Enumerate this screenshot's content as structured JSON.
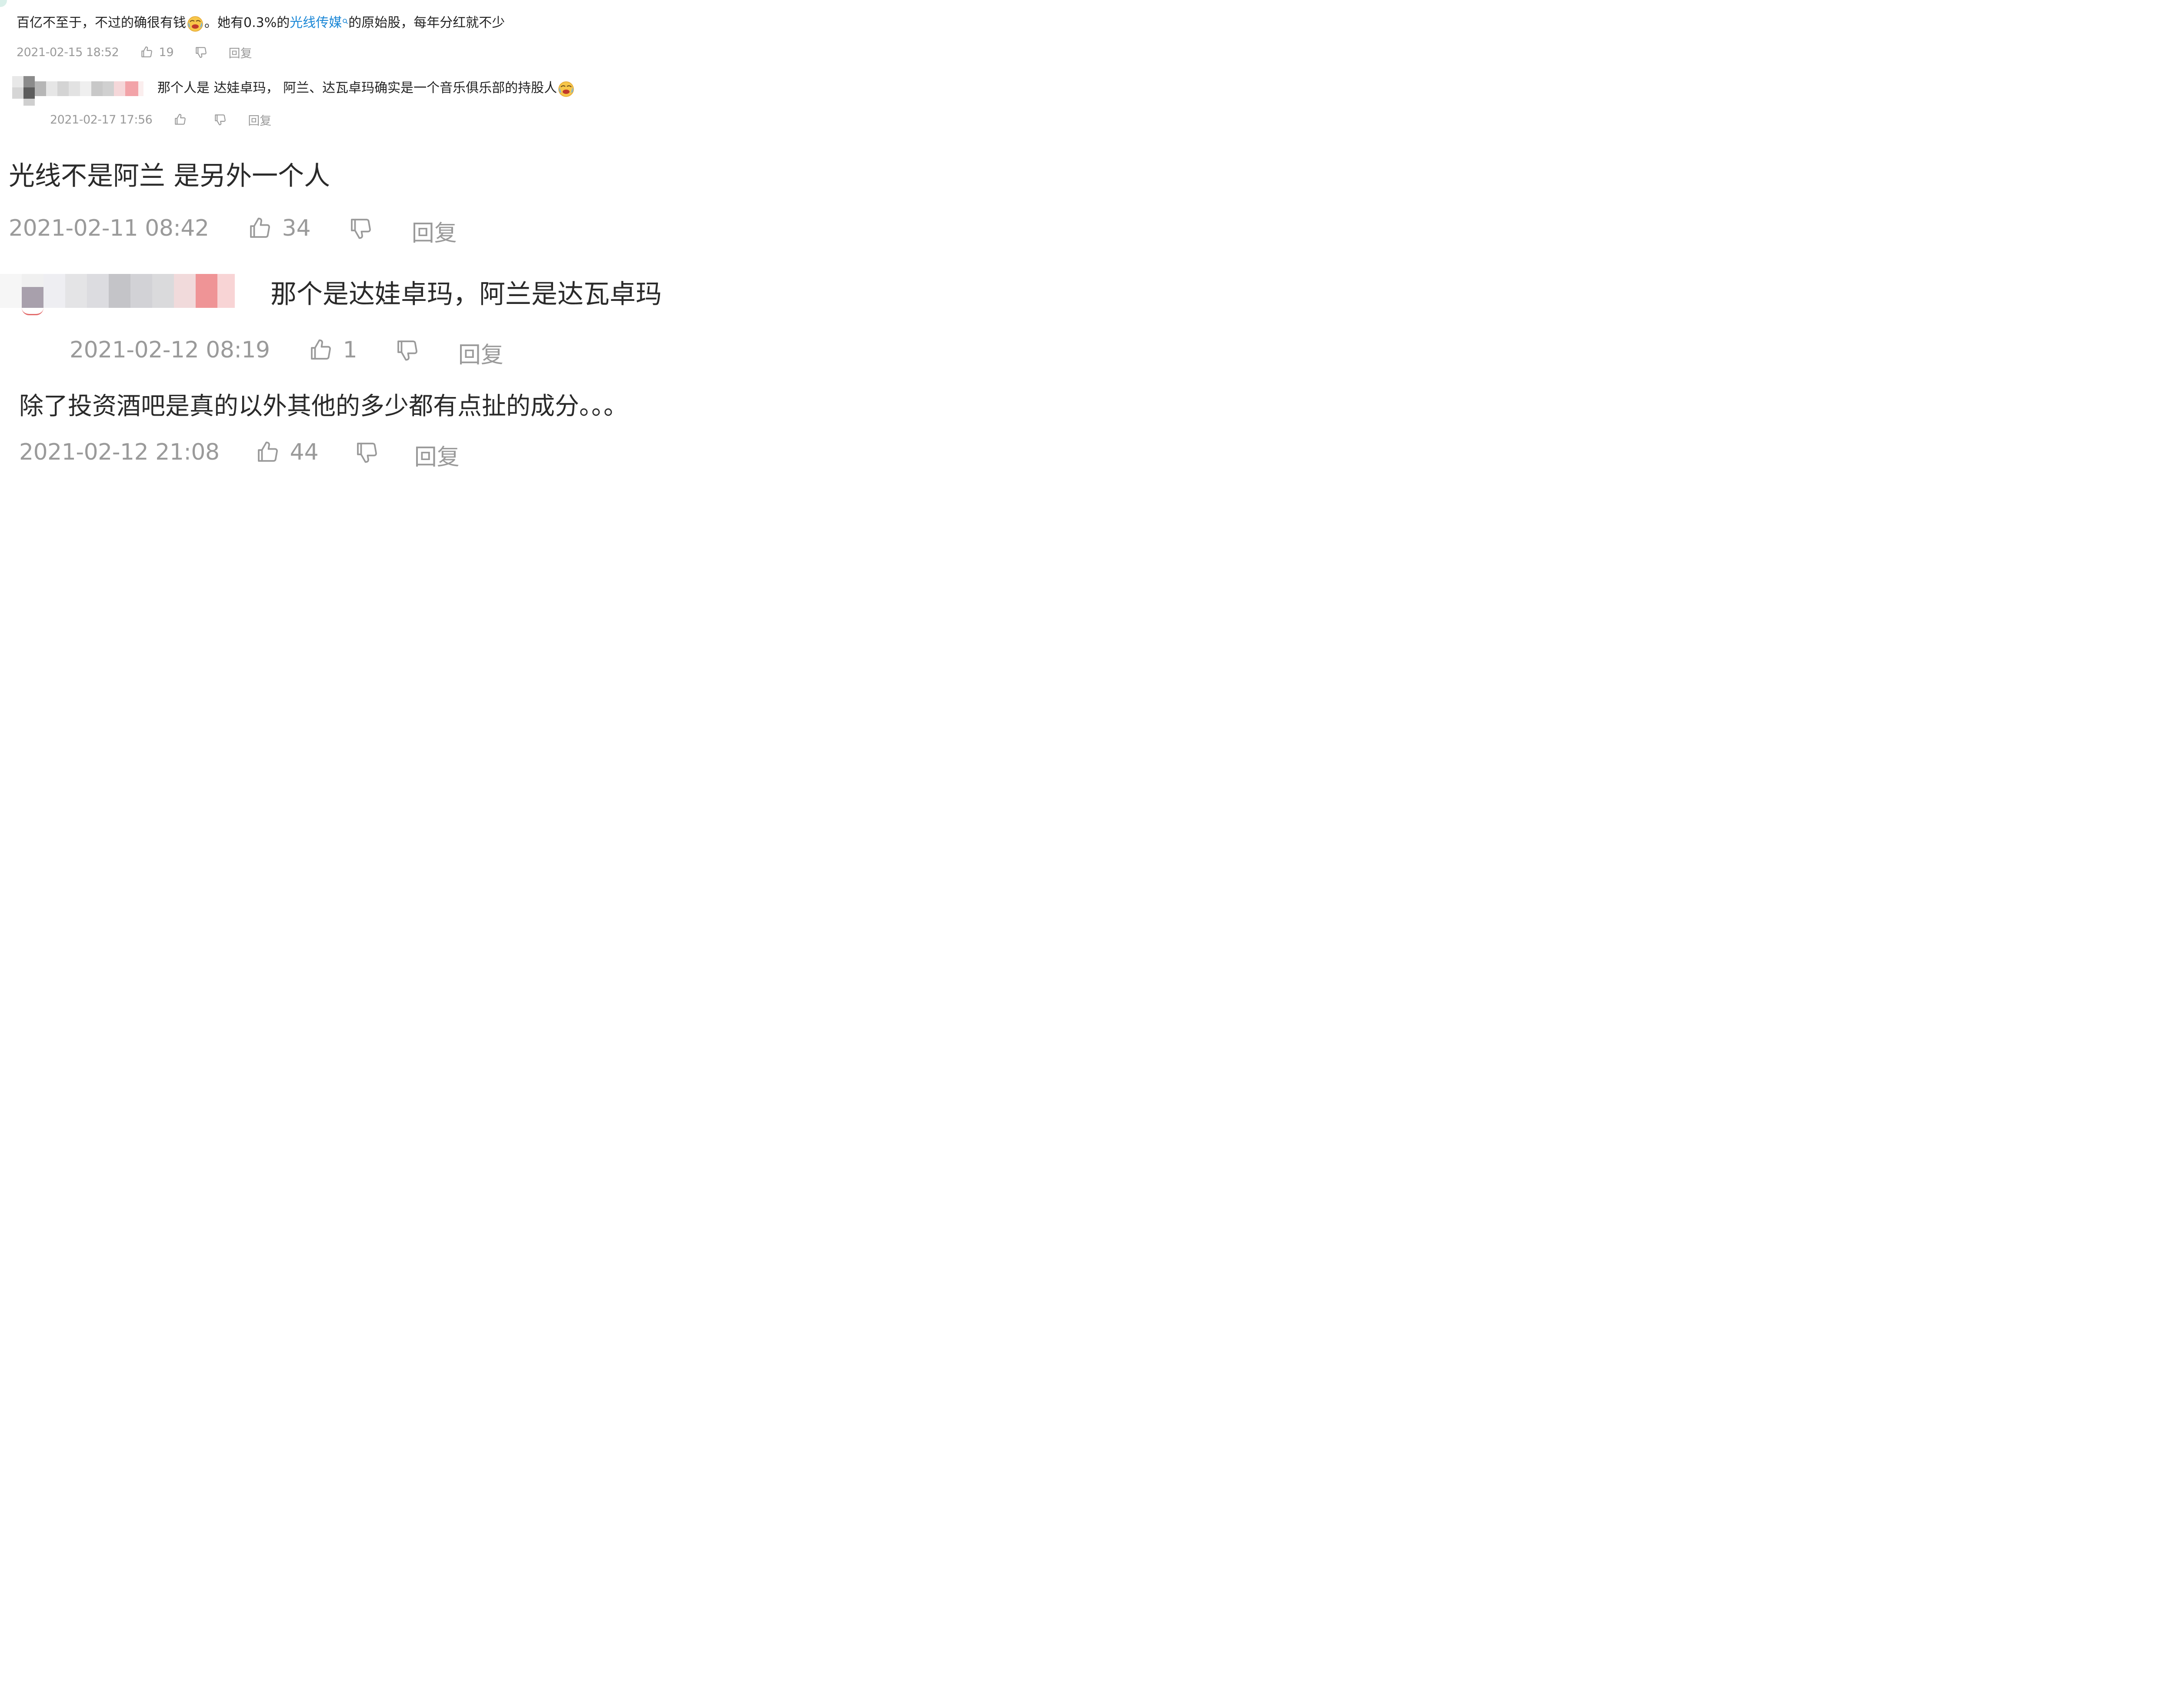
{
  "comments": [
    {
      "id": "c1",
      "text_before": "百亿不至于，不过的确很有钱",
      "text_middle": "。她有0.3%的",
      "link_text": "光线传媒",
      "text_after": "的原始股，每年分红就不少",
      "emoji": "crying-laugh-emoji",
      "time": "2021-02-15 18:52",
      "likes": "19",
      "reply_label": "回复"
    },
    {
      "id": "c2",
      "text_before": "那个人是 达娃卓玛， 阿兰、达瓦卓玛确实是一个音乐俱乐部的持股人",
      "emoji": "crying-laugh-emoji",
      "time": "2021-02-17 17:56",
      "likes": "",
      "reply_label": "回复"
    },
    {
      "id": "c3",
      "text_before": "光线不是阿兰 是另外一个人",
      "time": "2021-02-11 08:42",
      "likes": "34",
      "reply_label": "回复"
    },
    {
      "id": "c4",
      "text_before": "那个是达娃卓玛，阿兰是达瓦卓玛",
      "time": "2021-02-12 08:19",
      "likes": "1",
      "reply_label": "回复"
    },
    {
      "id": "c5",
      "text_before": "除了投资酒吧是真的以外其他的多少都有点扯的成分。。。",
      "time": "2021-02-12 21:08",
      "likes": "44",
      "reply_label": "回复"
    }
  ],
  "icons": {
    "like": "thumbs-up-icon",
    "dislike": "thumbs-down-icon",
    "search": "search-icon",
    "redacted_user": "pixelated-username"
  },
  "colors": {
    "link": "#1b87d6",
    "text": "#222222",
    "meta": "#9a9a9a"
  }
}
